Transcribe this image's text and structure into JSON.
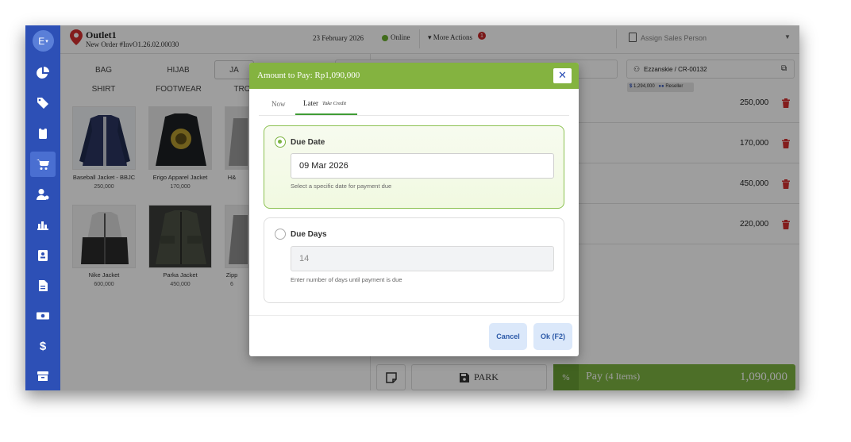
{
  "sidebar": {
    "avatar": "E"
  },
  "header": {
    "outlet_name": "Outlet1",
    "order_no": "New Order #InvO1.26.02.00030",
    "date": "23 February 2026",
    "status": "Online",
    "more_actions": "More Actions",
    "more_badge": "1",
    "assign_sales": "Assign Sales Person"
  },
  "categories": {
    "row1": [
      "BAG",
      "HIJAB",
      "JA"
    ],
    "row2": [
      "SHIRT",
      "FOOTWEAR",
      "TRO"
    ]
  },
  "products": [
    {
      "name": "Baseball Jacket - BBJC",
      "price": "250,000"
    },
    {
      "name": "Erigo Apparel Jacket",
      "price": "170,000"
    },
    {
      "name": "H&",
      "price": ""
    },
    {
      "name": "Nike Jacket",
      "price": "600,000"
    },
    {
      "name": "Parka Jacket",
      "price": "450,000"
    },
    {
      "name": "Zipp",
      "price": "6"
    }
  ],
  "customer": {
    "name": "Ezzanskie / CR-00132",
    "balance": "1,294,000",
    "tier": "Reseller"
  },
  "cart": {
    "prices": [
      "250,000",
      "170,000",
      "450,000",
      "220,000"
    ]
  },
  "footer": {
    "park_label": "PARK",
    "percent": "%",
    "pay_label": "Pay",
    "pay_items": "(4 Items)",
    "pay_total": "1,090,000"
  },
  "modal": {
    "title": "Amount to Pay: Rp1,090,000",
    "close": "✕",
    "tab_now": "Now",
    "tab_later": "Later",
    "tab_later_sub": "Take Credit",
    "due_date_title": "Due Date",
    "due_date_value": "09 Mar 2026",
    "due_date_help": "Select a specific date for payment due",
    "due_days_title": "Due Days",
    "due_days_value": "14",
    "due_days_help": "Enter number of days until payment is due",
    "cancel": "Cancel",
    "ok": "Ok (F2)"
  },
  "colors": {
    "sidebar": "#2d50b6",
    "accent_green": "#7cb342",
    "danger": "#d32f2f"
  }
}
